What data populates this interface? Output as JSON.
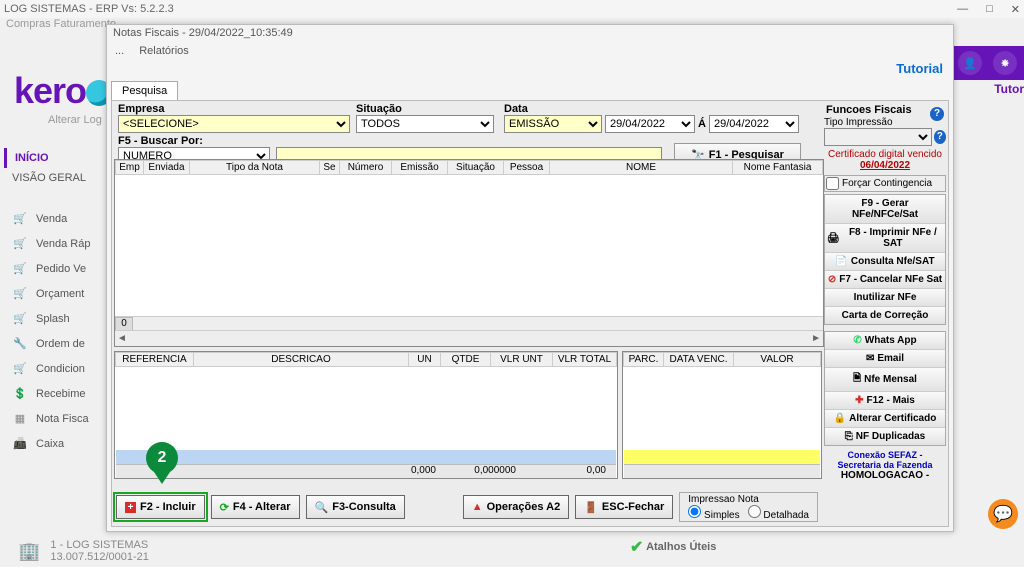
{
  "outer": {
    "title": "LOG SISTEMAS - ERP Vs: 5.2.2.3",
    "menu": "Compras   Faturamento",
    "brand_text": "kero",
    "brand_sub": "Alterar Log",
    "tutor_right": "Tutor"
  },
  "leftnav": {
    "inicio": "INÍCIO",
    "visao": "VISÃO GERAL",
    "items": [
      "Venda",
      "Venda Ráp",
      "Pedido Ve",
      "Orçament",
      "Splash",
      "Ordem de",
      "Condicion",
      "Recebime",
      "Nota Fisca",
      "Caixa"
    ]
  },
  "footer": {
    "company": "1 - LOG SISTEMAS",
    "cnpj": "13.007.512/0001-21",
    "atalhos": "Atalhos Úteis"
  },
  "dialog": {
    "title": "Notas Fiscais - 29/04/2022_10:35:49",
    "menu_more": "...",
    "menu_rel": "Relatórios",
    "tutorial": "Tutorial",
    "tab": "Pesquisa",
    "empresa_label": "Empresa",
    "empresa_value": "<SELECIONE>",
    "situacao_label": "Situação",
    "situacao_value": "TODOS",
    "data_label": "Data",
    "data_tipo": "EMISSÃO",
    "data1": "29/04/2022",
    "data_a": "Á",
    "data2": "29/04/2022",
    "buscar_label": "F5 - Buscar Por:",
    "buscar_value": "NUMERO",
    "pesquisar": "F1 - Pesquisar"
  },
  "grid1_headers": [
    "Emp",
    "Enviada",
    "Tipo da Nota",
    "Se",
    "Número",
    "Emissão",
    "Situação",
    "Pessoa",
    "NOME",
    "Nome Fantasia"
  ],
  "grid1_zero": "0",
  "grid2_headers": [
    "REFERENCIA",
    "DESCRICAO",
    "UN",
    "QTDE",
    "VLR UNT",
    "VLR TOTAL"
  ],
  "grid2_footer": {
    "qtde": "0,000",
    "vlr_unt": "0,000000",
    "vlr_total": "0,00"
  },
  "grid3_headers": [
    "PARC.",
    "DATA VENC.",
    "VALOR"
  ],
  "side": {
    "funcoes": "Funcoes Fiscais",
    "tipo_imp": "Tipo Impressão",
    "cert_msg": "Certificado digital vencido",
    "cert_date": "06/04/2022",
    "forcar": "Forçar Contingencia",
    "b_gerar": "F9 - Gerar NFe/NFCe/Sat",
    "b_imp": "F8 - Imprimir NFe / SAT",
    "b_cons": "Consulta Nfe/SAT",
    "b_canc": "F7 - Cancelar NFe Sat",
    "b_inut": "Inutilizar NFe",
    "b_carta": "Carta de Correção",
    "b_whats": "Whats App",
    "b_email": "Email",
    "b_mensal": "Nfe Mensal",
    "b_f12": "F12 - Mais",
    "b_altcert": "Alterar Certificado",
    "b_dup": "NF Duplicadas",
    "sefaz1": "Conexão SEFAZ -",
    "sefaz2": "Secretaria da Fazenda",
    "homolog": "HOMOLOGACAO -"
  },
  "bottom": {
    "incluir": "F2 - Incluir",
    "alterar": "F4 - Alterar",
    "consulta": "F3-Consulta",
    "oper": "Operações A2",
    "fechar": "ESC-Fechar",
    "imp_label": "Impressao Nota",
    "imp_simples": "Simples",
    "imp_det": "Detalhada"
  },
  "step": "2"
}
